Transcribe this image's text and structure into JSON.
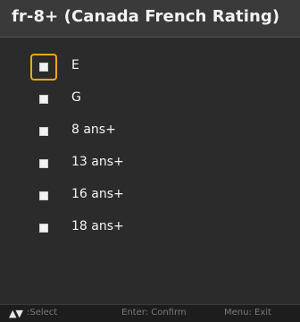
{
  "header": {
    "title": "fr-8+ (Canada French Rating)"
  },
  "ratings": {
    "items": [
      {
        "label": "E",
        "focused": true
      },
      {
        "label": "G",
        "focused": false
      },
      {
        "label": "8 ans+",
        "focused": false
      },
      {
        "label": "13 ans+",
        "focused": false
      },
      {
        "label": "16 ans+",
        "focused": false
      },
      {
        "label": "18 ans+",
        "focused": false
      }
    ]
  },
  "footer": {
    "nav_icon": "up-down-arrows-icon",
    "select_label": ":Select",
    "confirm_label": "Enter: Confirm",
    "exit_label": "Menu: Exit"
  },
  "colors": {
    "focus": "#f0a818",
    "title_bg": "#3a3a3a",
    "panel_bg": "#2b2b2b"
  }
}
